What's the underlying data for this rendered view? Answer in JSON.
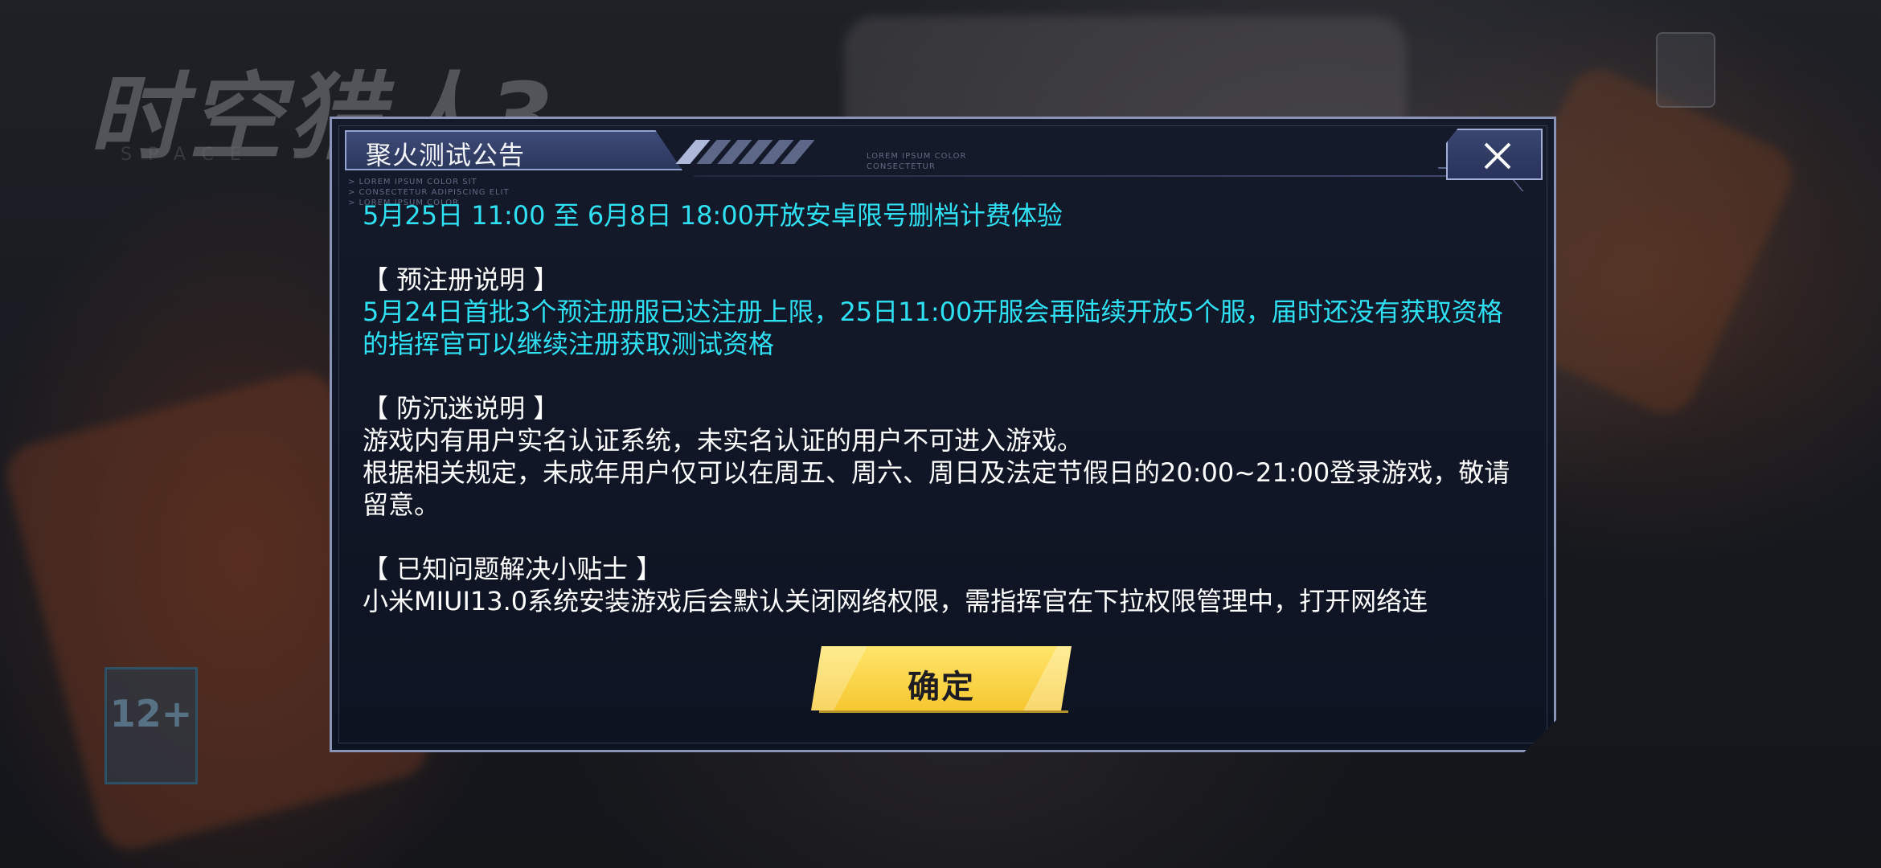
{
  "background": {
    "game_logo": "时空猎人3",
    "rating_badge": "12+"
  },
  "dialog": {
    "title": "聚火测试公告",
    "header_tiny_left": "> LOREM IPSUM COLOR SIT\n> CONSECTETUR ADIPISCING ELIT\n> LOREM IPSUM COLOR",
    "header_tiny_right": "LOREM IPSUM COLOR\nCONSECTETUR",
    "close_icon": "close-icon",
    "content": {
      "line_open": "5月25日 11:00 至 6月8日 18:00开放安卓限号删档计费体验",
      "section_preregister_heading": "【 预注册说明 】",
      "section_preregister_body": "5月24日首批3个预注册服已达注册上限，25日11:00开服会再陆续开放5个服，届时还没有获取资格的指挥官可以继续注册获取测试资格",
      "section_antiaddiction_heading": "【 防沉迷说明 】",
      "section_antiaddiction_line1": "游戏内有用户实名认证系统，未实名认证的用户不可进入游戏。",
      "section_antiaddiction_line2": "根据相关规定，未成年用户仅可以在周五、周六、周日及法定节假日的20:00~21:00登录游戏，敬请留意。",
      "section_tips_heading": "【 已知问题解决小贴士 】",
      "section_tips_body": "小米MIUI13.0系统安装游戏后会默认关闭网络权限，需指挥官在下拉权限管理中，打开网络连"
    },
    "confirm_label": "确定"
  },
  "colors": {
    "accent_cyan": "#2fe0f2",
    "confirm_yellow": "#f6c72f",
    "frame": "#8994b6"
  }
}
